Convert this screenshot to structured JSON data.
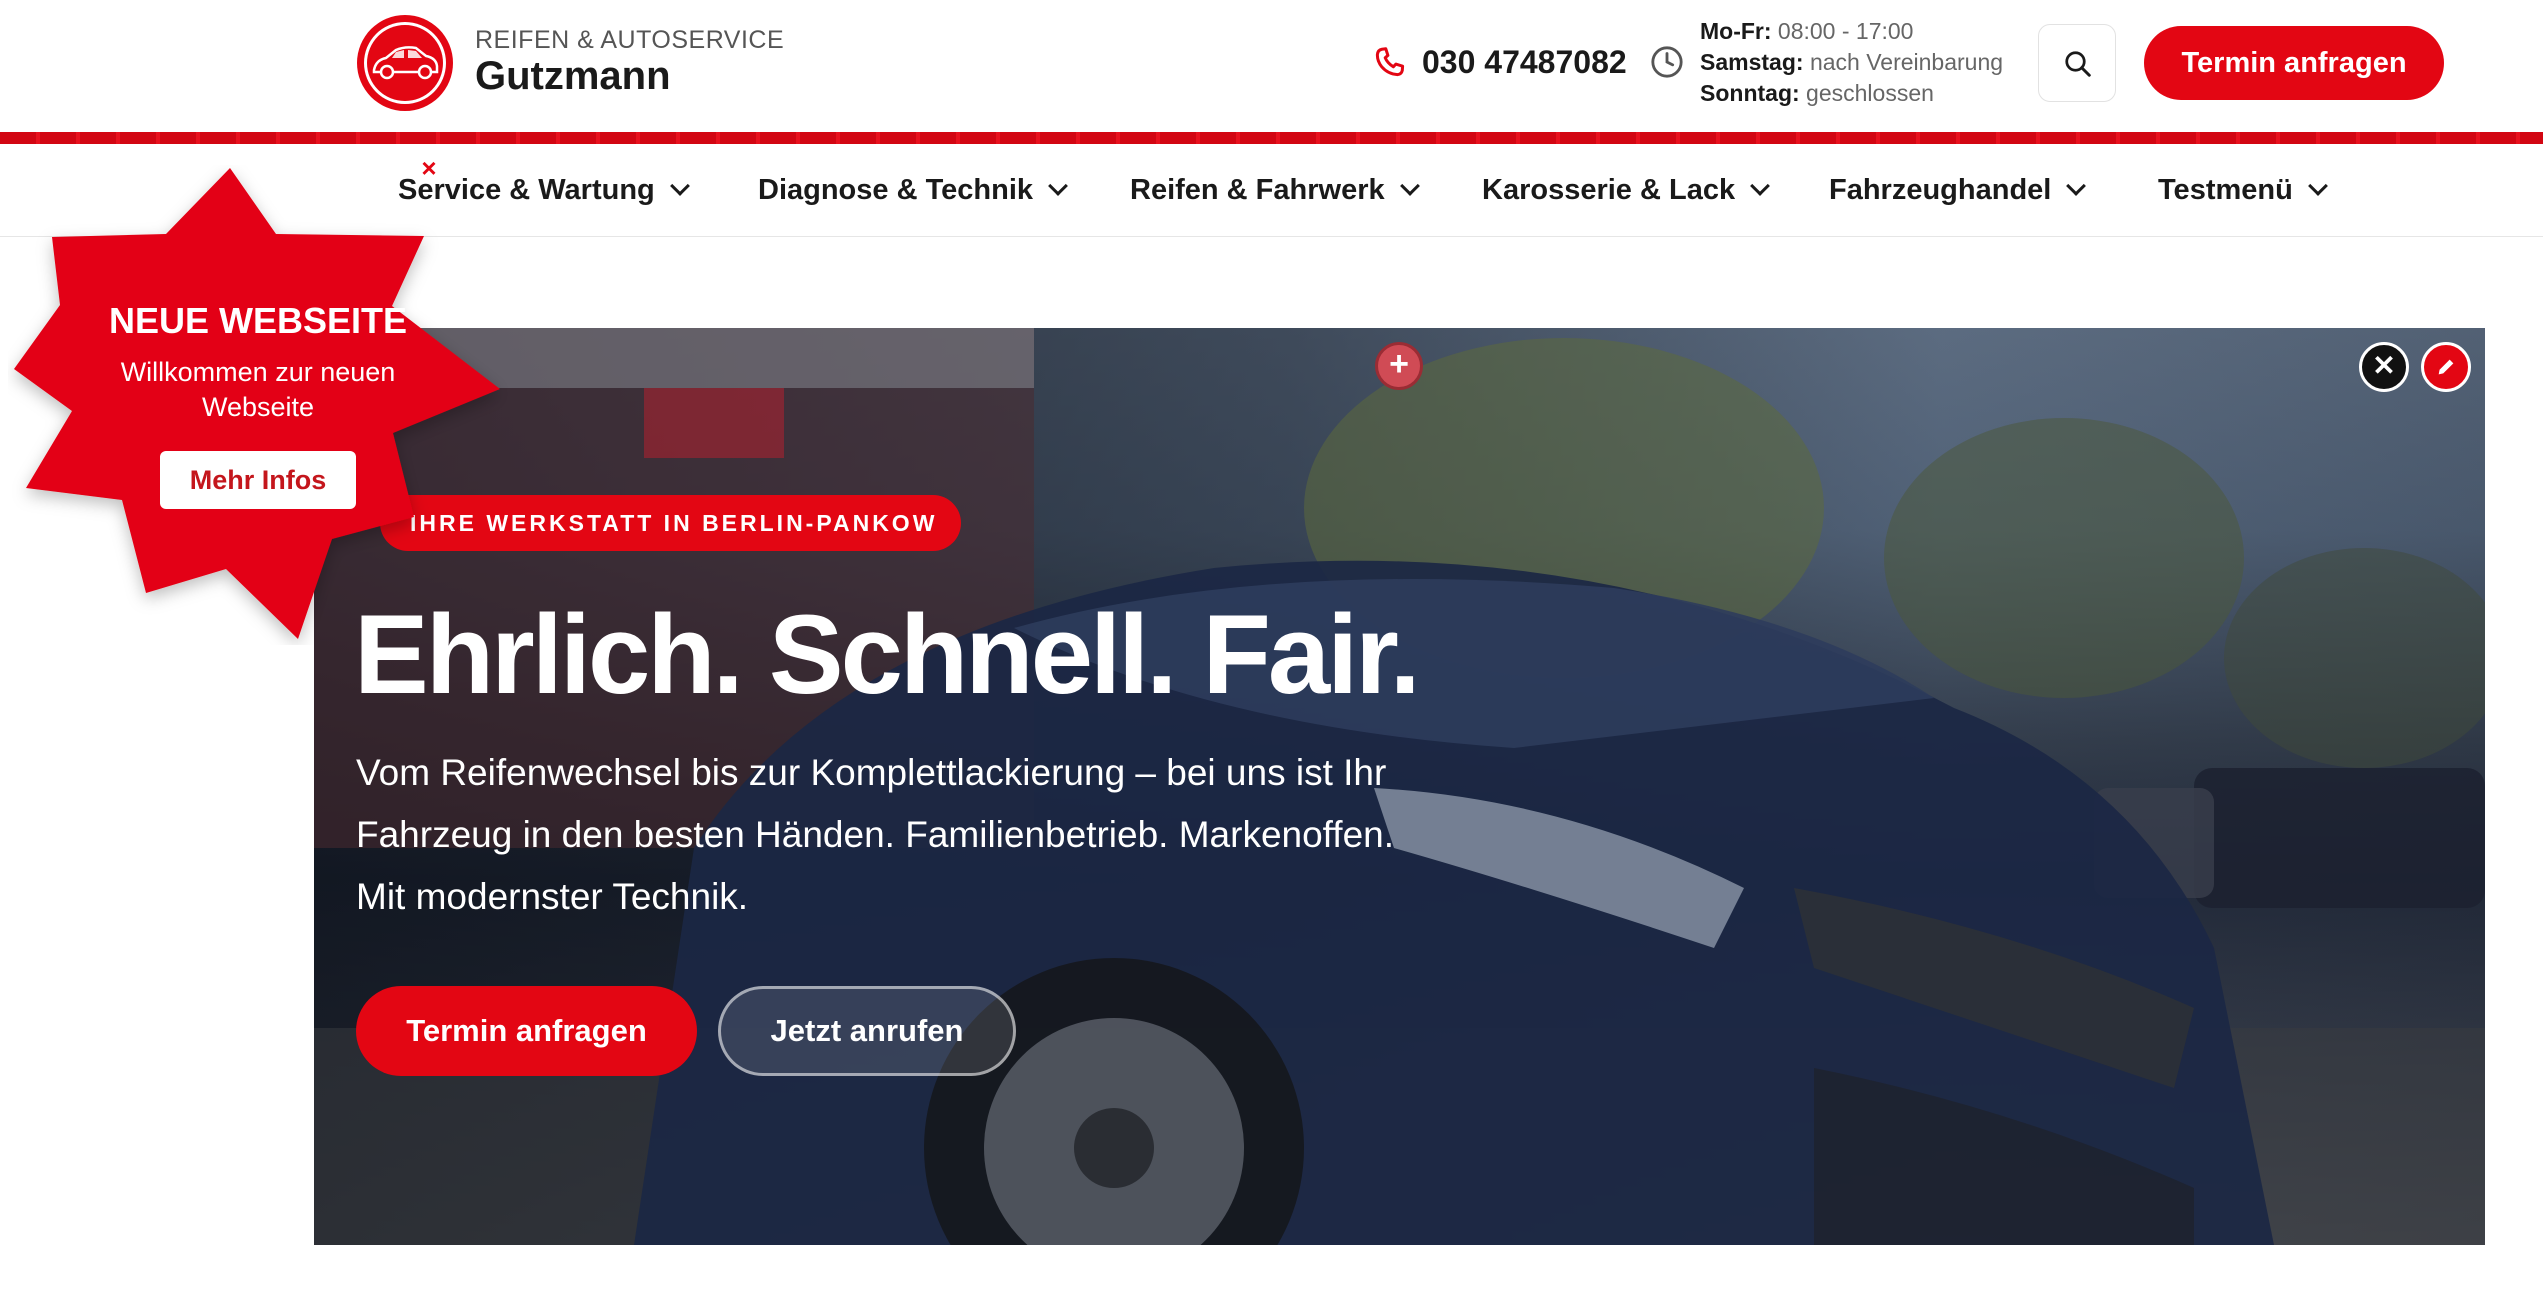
{
  "brand": {
    "subtitle": "REIFEN & AUTOSERVICE",
    "name": "Gutzmann"
  },
  "contact": {
    "phone": "030 47487082",
    "hours": [
      {
        "label": "Mo-Fr:",
        "value": "08:00 - 17:00"
      },
      {
        "label": "Samstag:",
        "value": "nach Vereinbarung"
      },
      {
        "label": "Sonntag:",
        "value": "geschlossen"
      }
    ]
  },
  "header": {
    "cta_label": "Termin anfragen"
  },
  "nav": {
    "items": [
      {
        "label": "Service & Wartung"
      },
      {
        "label": "Diagnose & Technik"
      },
      {
        "label": "Reifen & Fahrwerk"
      },
      {
        "label": "Karosserie & Lack"
      },
      {
        "label": "Fahrzeughandel"
      },
      {
        "label": "Testmenü"
      }
    ]
  },
  "hero": {
    "badge": "IHRE WERKSTATT IN BERLIN-PANKOW",
    "title": "Ehrlich. Schnell. Fair.",
    "text": "Vom Reifenwechsel bis zur Komplettlackierung – bei uns ist Ihr Fahrzeug in den besten Händen. Familienbetrieb. Markenoffen. Mit modernster Technik.",
    "primary_cta": "Termin anfragen",
    "secondary_cta": "Jetzt anrufen",
    "plus_symbol": "+",
    "close_symbol": "✕",
    "edit_icon": "pencil-icon"
  },
  "popup": {
    "title": "NEUE WEBSEITE",
    "text": "Willkommen zur neuen Webseite",
    "button": "Mehr Infos",
    "close_symbol": "×"
  },
  "colors": {
    "accent": "#e30613",
    "text": "#1a1a1a",
    "muted": "#666666"
  }
}
